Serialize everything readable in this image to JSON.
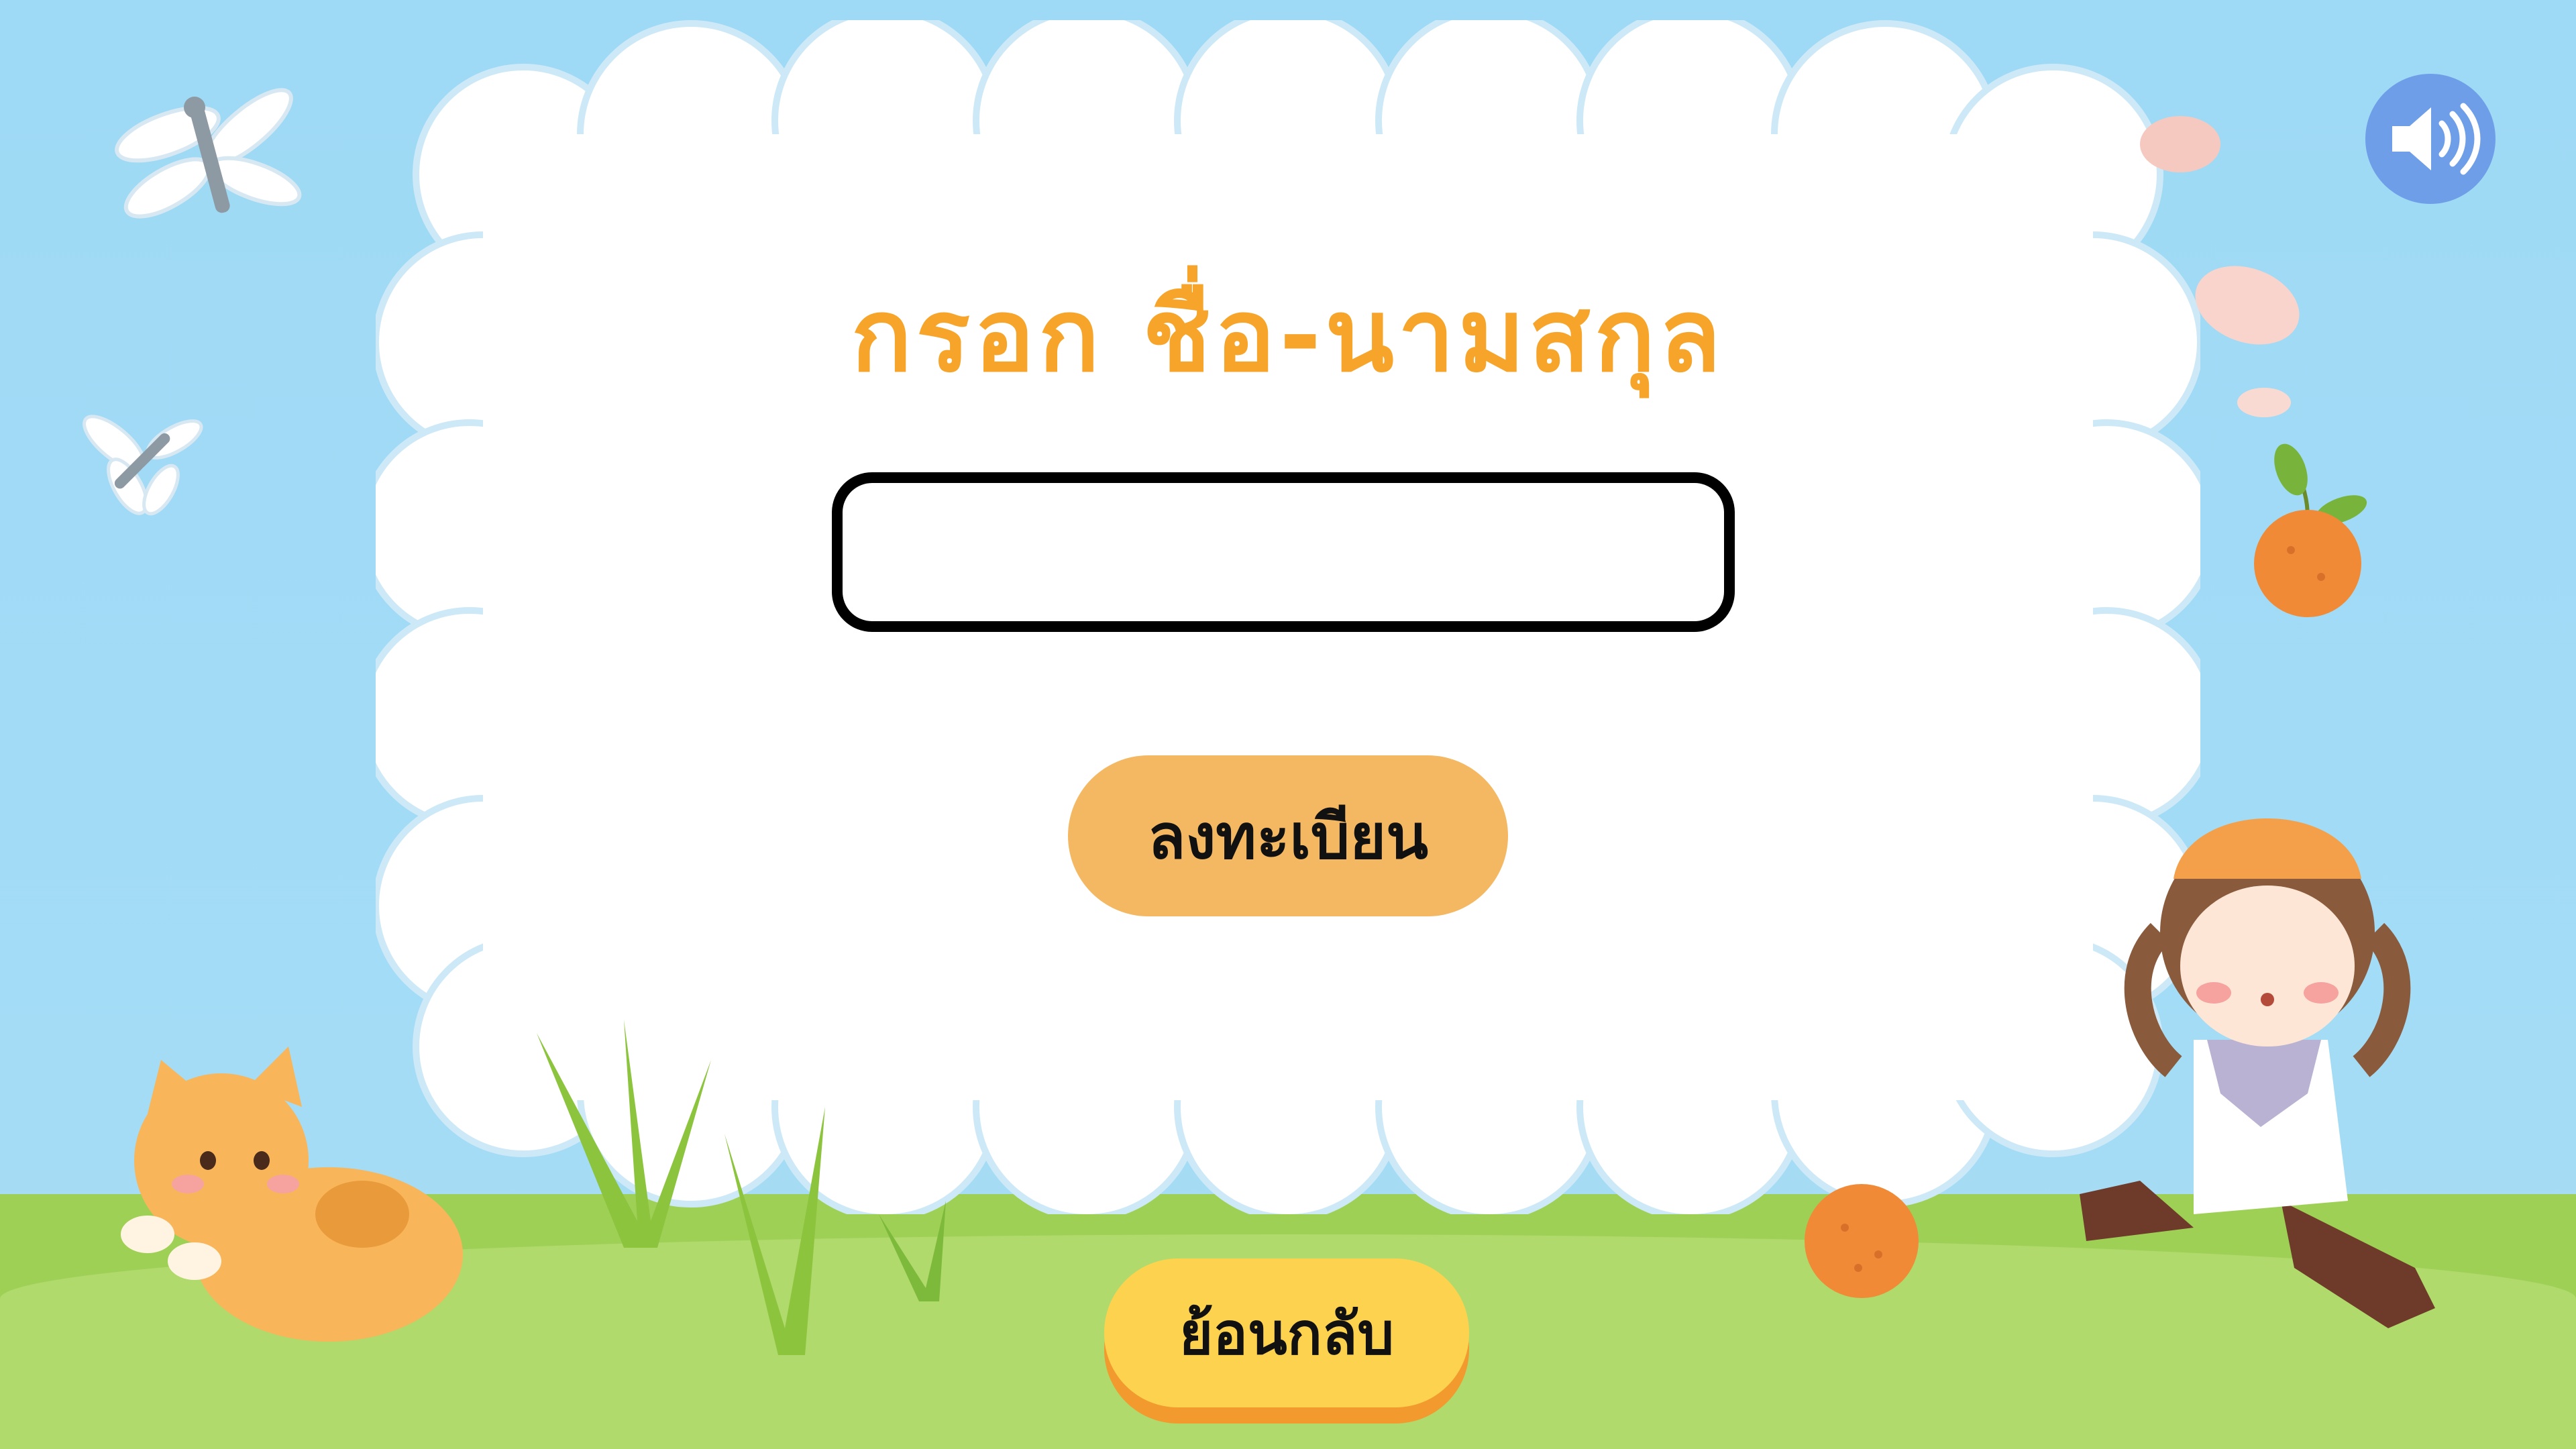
{
  "screen": {
    "title": "กรอก ชื่อ-นามสกุล",
    "name_input": {
      "value": "",
      "placeholder": ""
    },
    "register_button_label": "ลงทะเบียน",
    "back_button_label": "ย้อนกลับ"
  },
  "controls": {
    "sound_icon": "speaker-volume-icon"
  },
  "colors": {
    "sky": "#9ed9f5",
    "grass": "#9fd056",
    "title": "#f7a42a",
    "register_button": "#f4b862",
    "back_button": "#fdd24f",
    "back_button_shadow": "#f29a2e",
    "sound_button": "#6f9ee9"
  },
  "decorations": [
    "dragonfly-icon",
    "dragonfly-icon",
    "cat-illustration",
    "grass-tuft",
    "orange-fruit",
    "orange-fruit",
    "petal",
    "girl-illustration"
  ]
}
